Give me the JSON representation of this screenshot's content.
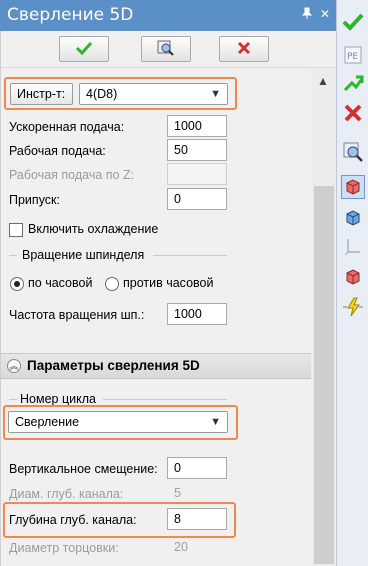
{
  "window": {
    "title": "Сверление 5D",
    "pin_icon": "pin-icon",
    "close_icon": "close-icon"
  },
  "actions": {
    "ok_icon": "check-icon",
    "preview_icon": "preview-icon",
    "cancel_icon": "x-icon"
  },
  "tool": {
    "label": "Инстр-т:",
    "value": "4(D8)"
  },
  "fields": {
    "rapid_feed": {
      "label": "Ускоренная подача:",
      "value": "1000"
    },
    "work_feed": {
      "label": "Рабочая подача:",
      "value": "50"
    },
    "z_feed": {
      "label": "Рабочая подача по Z:",
      "value": ""
    },
    "allowance": {
      "label": "Припуск:",
      "value": "0"
    },
    "coolant": {
      "label": "Включить охлаждение",
      "checked": false
    }
  },
  "spindle": {
    "group_label": "Вращение шпинделя",
    "cw": "по часовой",
    "ccw": "против часовой",
    "selected": "cw",
    "speed_label": "Частота вращения шп.:",
    "speed_value": "1000"
  },
  "section": {
    "title": "Параметры сверления 5D"
  },
  "cycle": {
    "group_label": "Номер цикла",
    "value": "Сверление"
  },
  "params": {
    "vertical_offset": {
      "label": "Вертикальное смещение:",
      "value": "0"
    },
    "hole_diameter": {
      "label": "Диам. глуб. канала:",
      "value": "5"
    },
    "hole_depth": {
      "label": "Глубина глуб. канала:",
      "value": "8"
    },
    "face_diameter": {
      "label": "Диаметр торцовки:",
      "value": "20"
    }
  },
  "colors": {
    "title_bar": "#5b8fc7",
    "highlight": "#f0894a",
    "ok_green": "#2fb42f",
    "cancel_red": "#d83030"
  }
}
